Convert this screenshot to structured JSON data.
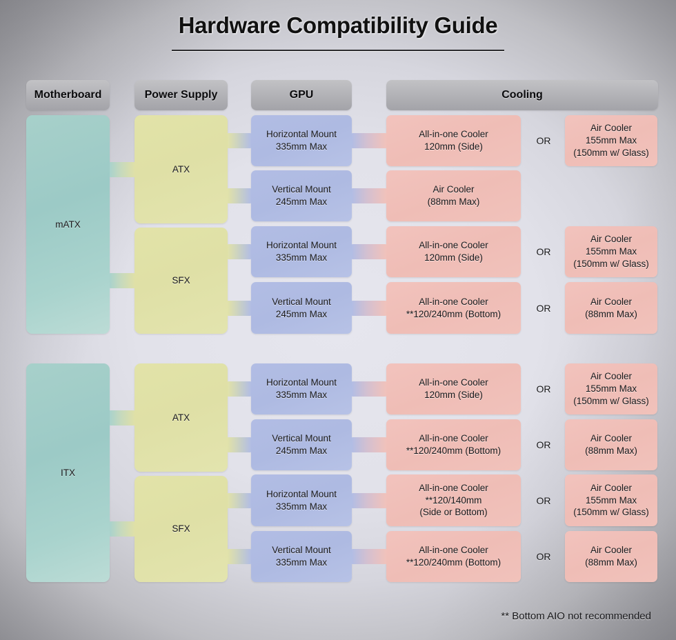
{
  "title": "Hardware Compatibility Guide",
  "footnote": "** Bottom AIO not recommended",
  "colors": {
    "header": "#b4b4b8",
    "motherboard": "#a7d0ca",
    "psu": "#e2e3a8",
    "gpu": "#b2bde4",
    "cooling": "#f2c3bd",
    "background": "#dcdce4"
  },
  "headers": [
    {
      "label": "Motherboard"
    },
    {
      "label": "Power Supply"
    },
    {
      "label": "GPU"
    },
    {
      "label": "Cooling"
    }
  ],
  "motherboards": [
    {
      "label": "mATX"
    },
    {
      "label": "ITX"
    }
  ],
  "power_supplies": [
    {
      "label": "ATX"
    },
    {
      "label": "SFX"
    },
    {
      "label": "ATX"
    },
    {
      "label": "SFX"
    }
  ],
  "gpus": [
    {
      "label": "Horizontal Mount\n335mm Max"
    },
    {
      "label": "Vertical Mount\n245mm Max"
    },
    {
      "label": "Horizontal Mount\n335mm Max"
    },
    {
      "label": "Vertical Mount\n245mm Max"
    },
    {
      "label": "Horizontal Mount\n335mm Max"
    },
    {
      "label": "Vertical Mount\n245mm Max"
    },
    {
      "label": "Horizontal Mount\n335mm Max"
    },
    {
      "label": "Vertical Mount\n335mm Max"
    }
  ],
  "cooling_primary": [
    {
      "label": "All-in-one Cooler\n120mm (Side)"
    },
    {
      "label": "Air Cooler\n(88mm Max)"
    },
    {
      "label": "All-in-one Cooler\n120mm (Side)"
    },
    {
      "label": "All-in-one Cooler\n**120/240mm (Bottom)"
    },
    {
      "label": "All-in-one Cooler\n120mm (Side)"
    },
    {
      "label": "All-in-one Cooler\n**120/240mm (Bottom)"
    },
    {
      "label": "All-in-one Cooler\n**120/140mm\n(Side or Bottom)"
    },
    {
      "label": "All-in-one Cooler\n**120/240mm (Bottom)"
    }
  ],
  "cooling_or": [
    {
      "label": "OR"
    },
    {
      "label": ""
    },
    {
      "label": "OR"
    },
    {
      "label": "OR"
    },
    {
      "label": "OR"
    },
    {
      "label": "OR"
    },
    {
      "label": "OR"
    },
    {
      "label": "OR"
    }
  ],
  "cooling_alternate": [
    {
      "label": "Air Cooler\n155mm Max\n(150mm w/ Glass)"
    },
    {
      "label": ""
    },
    {
      "label": "Air Cooler\n155mm Max\n(150mm w/ Glass)"
    },
    {
      "label": "Air Cooler\n(88mm Max)"
    },
    {
      "label": "Air Cooler\n155mm Max\n(150mm w/ Glass)"
    },
    {
      "label": "Air Cooler\n(88mm Max)"
    },
    {
      "label": "Air Cooler\n155mm Max\n(150mm w/ Glass)"
    },
    {
      "label": "Air Cooler\n(88mm Max)"
    }
  ]
}
